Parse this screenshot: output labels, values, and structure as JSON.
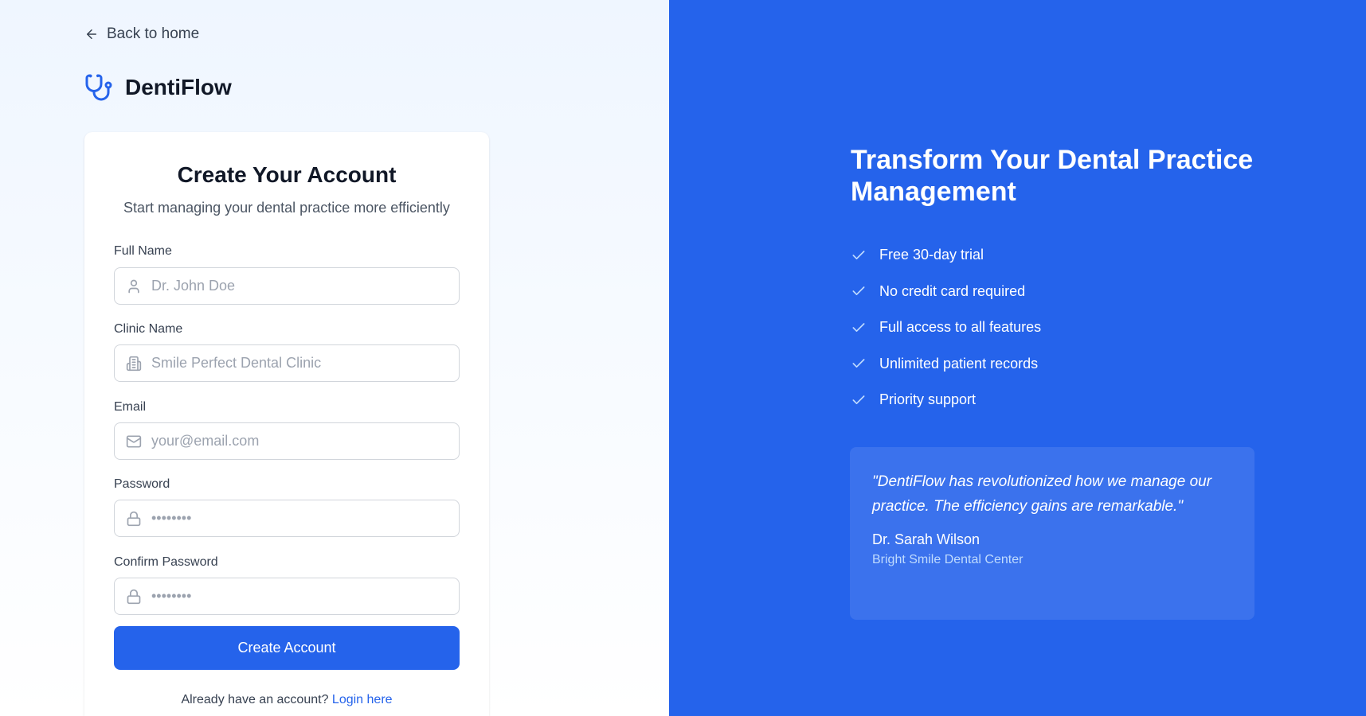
{
  "nav": {
    "back_label": "Back to home"
  },
  "brand": {
    "name": "DentiFlow"
  },
  "form": {
    "title": "Create Your Account",
    "subtitle": "Start managing your dental practice more efficiently",
    "fields": [
      {
        "label": "Full Name",
        "placeholder": "Dr. John Doe",
        "type": "text",
        "icon": "user-icon"
      },
      {
        "label": "Clinic Name",
        "placeholder": "Smile Perfect Dental Clinic",
        "type": "text",
        "icon": "building-icon"
      },
      {
        "label": "Email",
        "placeholder": "your@email.com",
        "type": "email",
        "icon": "mail-icon"
      },
      {
        "label": "Password",
        "placeholder": "••••••••",
        "type": "password",
        "icon": "lock-icon"
      },
      {
        "label": "Confirm Password",
        "placeholder": "••••••••",
        "type": "password",
        "icon": "lock-icon"
      }
    ],
    "submit_label": "Create Account",
    "login_prompt": "Already have an account?",
    "login_link": "Login here"
  },
  "hero": {
    "title": "Transform Your Dental Practice Management",
    "features": [
      "Free 30-day trial",
      "No credit card required",
      "Full access to all features",
      "Unlimited patient records",
      "Priority support"
    ],
    "testimonial": {
      "quote": "\"DentiFlow has revolutionized how we manage our practice. The efficiency gains are remarkable.\"",
      "author": "Dr. Sarah Wilson",
      "organization": "Bright Smile Dental Center"
    }
  },
  "colors": {
    "accent": "#2563eb",
    "panel_bg": "#2563eb",
    "page_bg": "#eff6ff",
    "text_dark": "#111827",
    "muted": "#9ca3af"
  }
}
